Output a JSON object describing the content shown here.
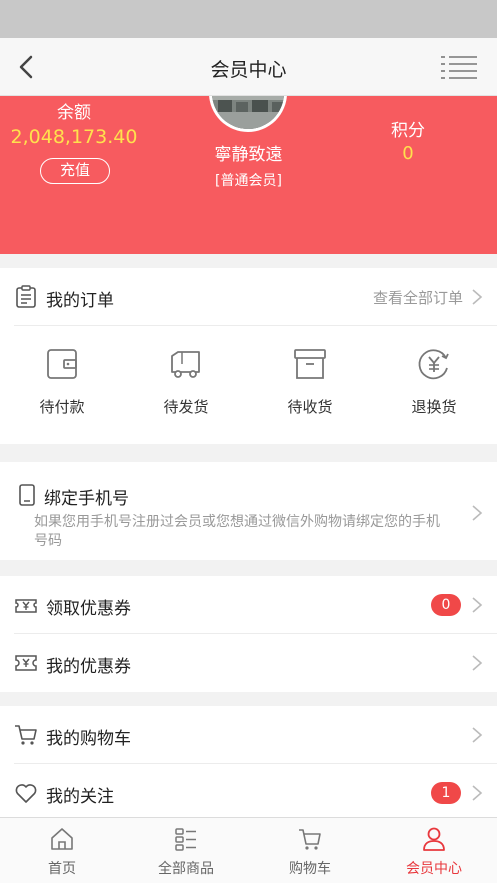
{
  "nav": {
    "title": "会员中心"
  },
  "profile": {
    "balance_label": "余额",
    "balance_value": "2,048,173.40",
    "recharge_label": "充值",
    "nickname": "寧静致遠",
    "level": "[普通会员]",
    "points_label": "积分",
    "points_value": "0"
  },
  "orders": {
    "title": "我的订单",
    "view_all": "查看全部订单",
    "items": [
      {
        "label": "待付款",
        "icon": "wallet-icon"
      },
      {
        "label": "待发货",
        "icon": "truck-icon"
      },
      {
        "label": "待收货",
        "icon": "box-icon"
      },
      {
        "label": "退换货",
        "icon": "yen-return-icon"
      }
    ]
  },
  "bind_phone": {
    "title": "绑定手机号",
    "desc": "如果您用手机号注册过会员或您想通过微信外购物请绑定您的手机号码"
  },
  "coupons": {
    "get_label": "领取优惠券",
    "get_count": "0",
    "mine_label": "我的优惠券"
  },
  "more": {
    "cart_label": "我的购物车",
    "follow_label": "我的关注",
    "follow_count": "1"
  },
  "tabbar": {
    "items": [
      {
        "label": "首页",
        "icon": "home-icon"
      },
      {
        "label": "全部商品",
        "icon": "list-icon"
      },
      {
        "label": "购物车",
        "icon": "cart-icon"
      },
      {
        "label": "会员中心",
        "icon": "user-icon"
      }
    ],
    "active_index": 3
  },
  "colors": {
    "accent": "#f75b5f",
    "highlight": "#ffe14d",
    "badge": "#f04848",
    "active_tab": "#e8383d"
  }
}
